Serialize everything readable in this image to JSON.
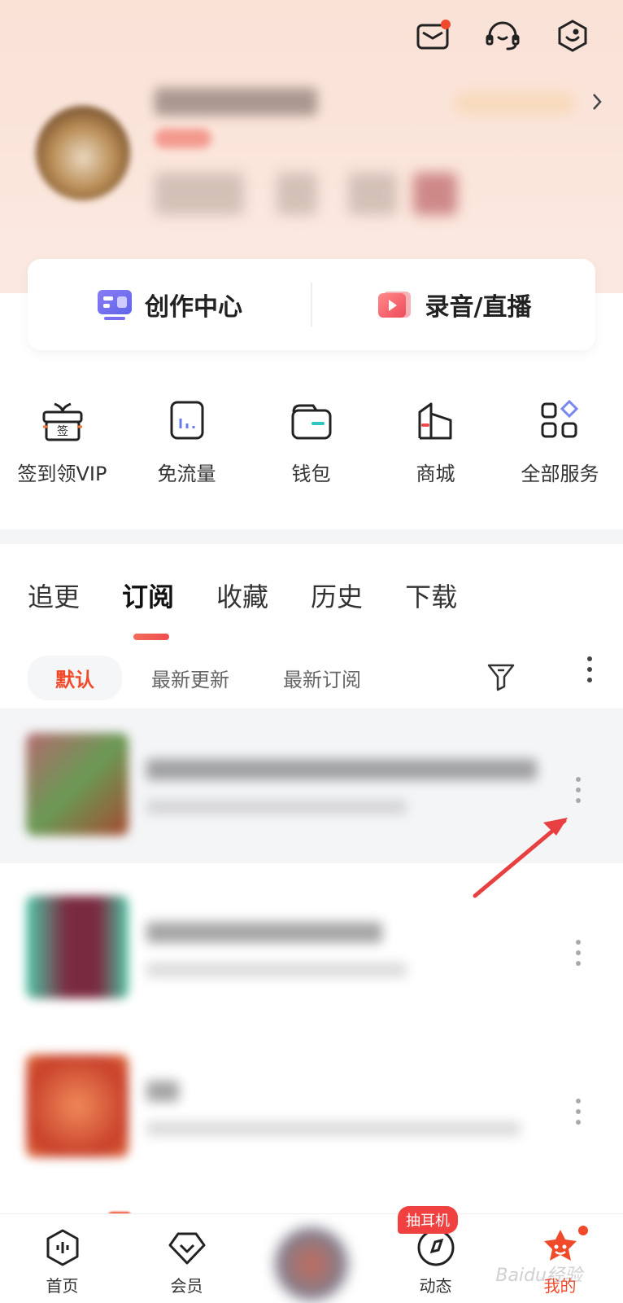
{
  "header": {
    "icons": [
      "mail-icon",
      "customer-service-icon",
      "scan-icon"
    ]
  },
  "creator": {
    "center_label": "创作中心",
    "record_label": "录音/直播"
  },
  "services": [
    {
      "label": "签到领VIP",
      "icon": "gift-sign-icon",
      "glyph": "签"
    },
    {
      "label": "免流量",
      "icon": "data-free-icon"
    },
    {
      "label": "钱包",
      "icon": "wallet-icon"
    },
    {
      "label": "商城",
      "icon": "mall-icon"
    },
    {
      "label": "全部服务",
      "icon": "all-services-icon"
    }
  ],
  "tabs": [
    {
      "label": "追更",
      "active": false
    },
    {
      "label": "订阅",
      "active": true
    },
    {
      "label": "收藏",
      "active": false
    },
    {
      "label": "历史",
      "active": false
    },
    {
      "label": "下载",
      "active": false
    }
  ],
  "sorts": [
    {
      "label": "默认",
      "active": true
    },
    {
      "label": "最新更新",
      "active": false
    },
    {
      "label": "最新订阅",
      "active": false
    }
  ],
  "bottom_nav": [
    {
      "label": "首页",
      "icon": "home-icon"
    },
    {
      "label": "会员",
      "icon": "vip-icon"
    },
    {
      "label": "",
      "icon": "now-playing"
    },
    {
      "label": "动态",
      "icon": "feed-icon",
      "badge": "抽耳机"
    },
    {
      "label": "我的",
      "icon": "mine-icon",
      "active": true
    }
  ],
  "watermark": "Baidu经验",
  "colors": {
    "accent": "#f04a2a",
    "arrow": "#e84040"
  }
}
